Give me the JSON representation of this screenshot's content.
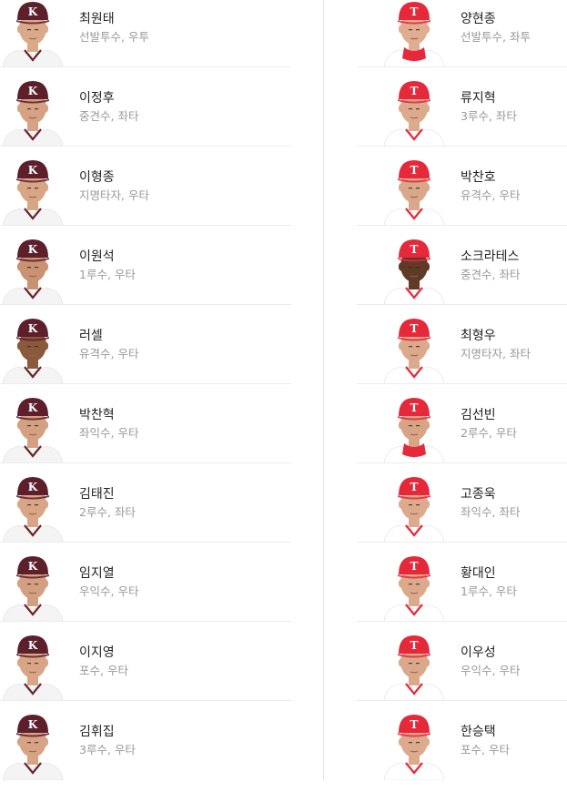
{
  "colors": {
    "away_cap": "#5c1f2b",
    "away_uniform": "#f4f4f4",
    "away_trim": "#6a2431",
    "home_cap": "#e5283a",
    "home_uniform": "#ffffff",
    "home_trim": "#e5283a",
    "name_text": "#222222",
    "position_text": "#999999",
    "separator": "#ececec"
  },
  "away": {
    "cap_logo": "K",
    "players": [
      {
        "name": "최원태",
        "position": "선발투수, 우투"
      },
      {
        "name": "이정후",
        "position": "중견수, 좌타"
      },
      {
        "name": "이형종",
        "position": "지명타자, 우타"
      },
      {
        "name": "이원석",
        "position": "1루수, 우타"
      },
      {
        "name": "러셀",
        "position": "유격수, 우타"
      },
      {
        "name": "박찬혁",
        "position": "좌익수, 우타"
      },
      {
        "name": "김태진",
        "position": "2루수, 좌타"
      },
      {
        "name": "임지열",
        "position": "우익수, 우타"
      },
      {
        "name": "이지영",
        "position": "포수, 우타"
      },
      {
        "name": "김휘집",
        "position": "3루수, 우타"
      }
    ]
  },
  "home": {
    "cap_logo": "T",
    "players": [
      {
        "name": "양현종",
        "position": "선발투수, 좌투"
      },
      {
        "name": "류지혁",
        "position": "3루수, 좌타"
      },
      {
        "name": "박찬호",
        "position": "유격수, 우타"
      },
      {
        "name": "소크라테스",
        "position": "중견수, 좌타"
      },
      {
        "name": "최형우",
        "position": "지명타자, 좌타"
      },
      {
        "name": "김선빈",
        "position": "2루수, 우타"
      },
      {
        "name": "고종욱",
        "position": "좌익수, 좌타"
      },
      {
        "name": "황대인",
        "position": "1루수, 우타"
      },
      {
        "name": "이우성",
        "position": "우익수, 우타"
      },
      {
        "name": "한승택",
        "position": "포수, 우타"
      }
    ]
  }
}
